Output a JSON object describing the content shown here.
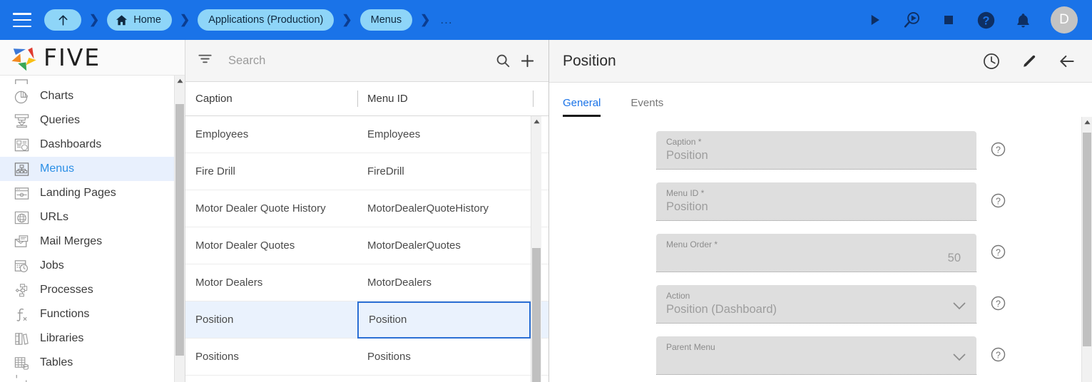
{
  "topbar": {
    "menu_icon": "hamburger-icon",
    "breadcrumbs": [
      {
        "label": "",
        "icon": "arrow-up-icon",
        "type": "up"
      },
      {
        "label": "Home",
        "icon": "home-icon",
        "type": "home"
      },
      {
        "label": "Applications (Production)",
        "icon": "",
        "type": "crumb"
      },
      {
        "label": "Menus",
        "icon": "",
        "type": "crumb"
      }
    ],
    "overflow": "...",
    "actions": [
      {
        "name": "run-icon",
        "title": "Run"
      },
      {
        "name": "debug-icon",
        "title": "Debug"
      },
      {
        "name": "stop-icon",
        "title": "Stop"
      },
      {
        "name": "help-icon",
        "title": "Help"
      },
      {
        "name": "notifications-bell-icon",
        "title": "Notifications"
      }
    ],
    "avatar_initial": "D",
    "bar_color": "#1a73e8",
    "chip_color": "#8ed5f8"
  },
  "sidebar": {
    "logo_text": "FIVE",
    "items": [
      {
        "label": "Charts",
        "icon": "chart-icon",
        "active": false
      },
      {
        "label": "Queries",
        "icon": "query-icon",
        "active": false
      },
      {
        "label": "Dashboards",
        "icon": "dashboard-icon",
        "active": false
      },
      {
        "label": "Menus",
        "icon": "menu-tree-icon",
        "active": true
      },
      {
        "label": "Landing Pages",
        "icon": "landing-page-icon",
        "active": false
      },
      {
        "label": "URLs",
        "icon": "globe-icon",
        "active": false
      },
      {
        "label": "Mail Merges",
        "icon": "mail-merge-icon",
        "active": false
      },
      {
        "label": "Jobs",
        "icon": "jobs-calendar-icon",
        "active": false
      },
      {
        "label": "Processes",
        "icon": "process-flow-icon",
        "active": false
      },
      {
        "label": "Functions",
        "icon": "function-icon",
        "active": false
      },
      {
        "label": "Libraries",
        "icon": "libraries-icon",
        "active": false
      },
      {
        "label": "Tables",
        "icon": "table-icon",
        "active": false
      }
    ]
  },
  "list_panel": {
    "search": {
      "placeholder": "Search",
      "value": ""
    },
    "filter_icon": "filter-list-icon",
    "search_icon": "search-icon",
    "add_icon": "plus-icon",
    "columns": [
      "Caption",
      "Menu ID"
    ],
    "rows": [
      {
        "caption": "Employees",
        "menu_id": "Employees",
        "selected": false
      },
      {
        "caption": "Fire Drill",
        "menu_id": "FireDrill",
        "selected": false
      },
      {
        "caption": "Motor Dealer Quote History",
        "menu_id": "MotorDealerQuoteHistory",
        "selected": false
      },
      {
        "caption": "Motor Dealer Quotes",
        "menu_id": "MotorDealerQuotes",
        "selected": false
      },
      {
        "caption": "Motor Dealers",
        "menu_id": "MotorDealers",
        "selected": false
      },
      {
        "caption": "Position",
        "menu_id": "Position",
        "selected": true
      },
      {
        "caption": "Positions",
        "menu_id": "Positions",
        "selected": false
      }
    ]
  },
  "detail": {
    "title": "Position",
    "actions": [
      {
        "name": "history-clock-icon",
        "title": "History"
      },
      {
        "name": "edit-pencil-icon",
        "title": "Edit"
      },
      {
        "name": "back-arrow-icon",
        "title": "Back"
      }
    ],
    "tabs": [
      {
        "label": "General",
        "active": true
      },
      {
        "label": "Events",
        "active": false
      }
    ],
    "fields": [
      {
        "label": "Caption *",
        "value": "Position",
        "type": "text",
        "align": "left",
        "help": "help-icon"
      },
      {
        "label": "Menu ID *",
        "value": "Position",
        "type": "text",
        "align": "left",
        "help": "help-icon"
      },
      {
        "label": "Menu Order *",
        "value": "50",
        "type": "number",
        "align": "right",
        "help": "help-icon"
      },
      {
        "label": "Action",
        "value": "Position (Dashboard)",
        "type": "select",
        "align": "left",
        "help": "help-icon"
      },
      {
        "label": "Parent Menu",
        "value": "",
        "type": "select",
        "align": "left",
        "help": "help-icon"
      }
    ]
  }
}
